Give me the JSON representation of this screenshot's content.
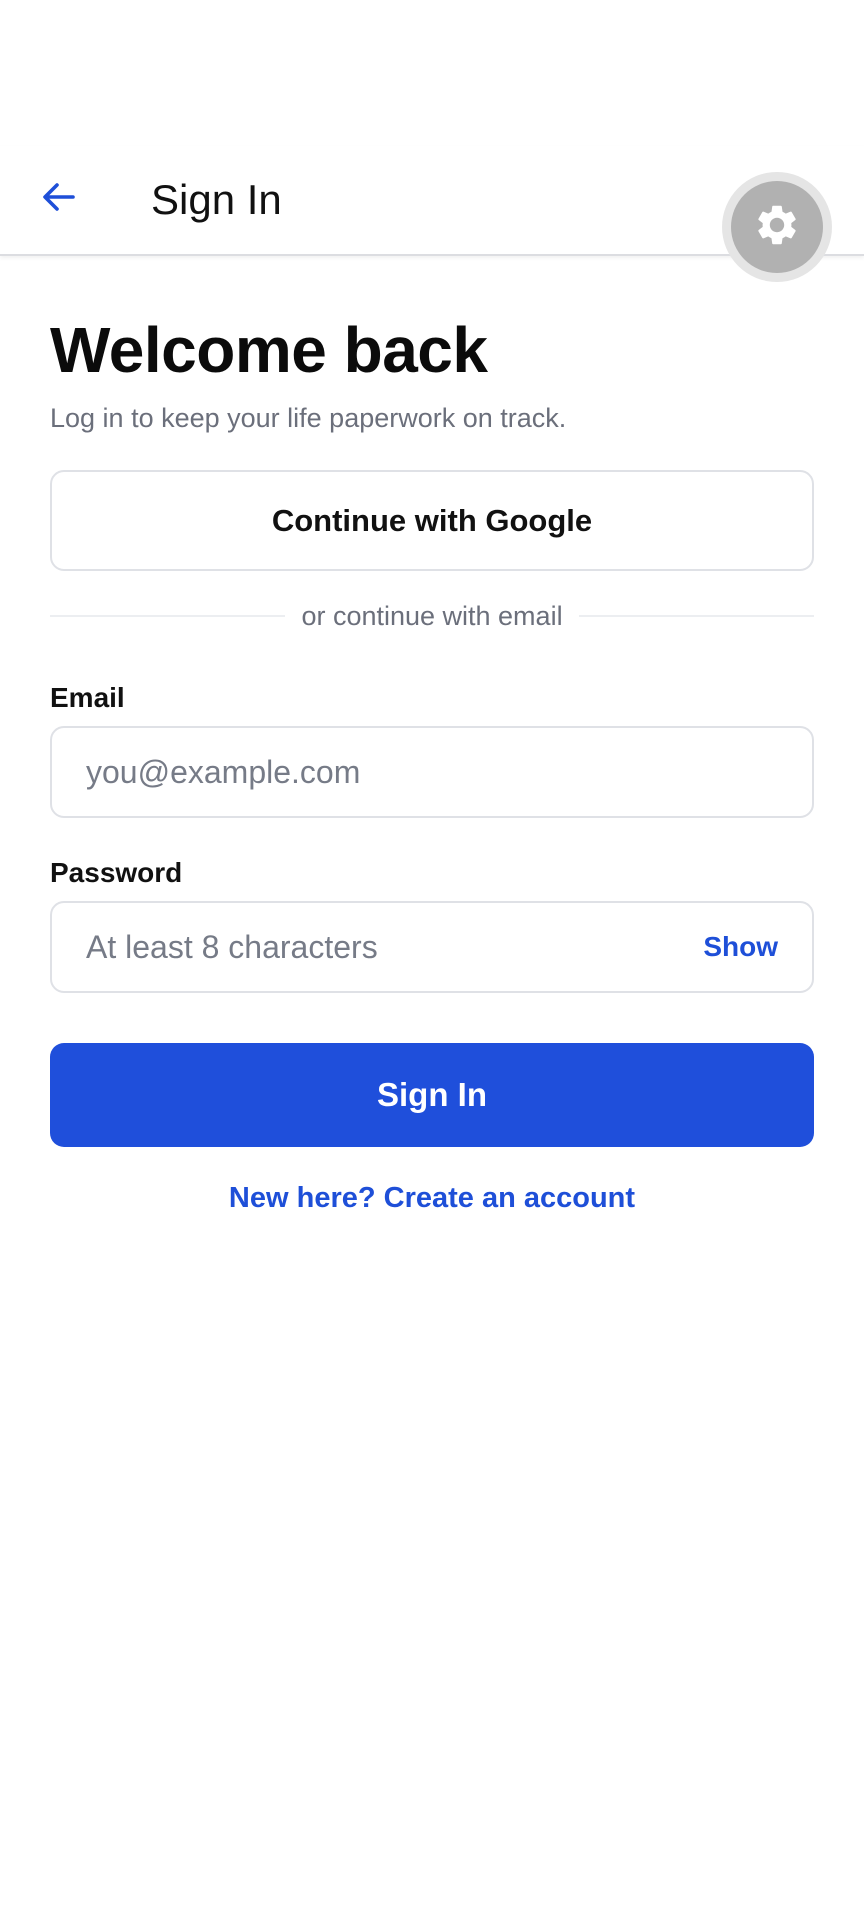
{
  "app_bar": {
    "title": "Sign In",
    "back_icon": "arrow-left-icon",
    "settings_icon": "gear-icon"
  },
  "main": {
    "heading": "Welcome back",
    "subheading": "Log in to keep your life paperwork on track.",
    "google_button_label": "Continue with Google",
    "divider_text": "or continue with email",
    "email": {
      "label": "Email",
      "value": "",
      "placeholder": "you@example.com"
    },
    "password": {
      "label": "Password",
      "value": "",
      "placeholder": "At least 8 characters",
      "toggle_label": "Show"
    },
    "submit_label": "Sign In",
    "create_account_link": "New here? Create an account"
  },
  "colors": {
    "accent": "#1f4fdb",
    "muted_text": "#6b6f7b",
    "border": "#dfe1e6",
    "fab": "#b1b1b1"
  }
}
